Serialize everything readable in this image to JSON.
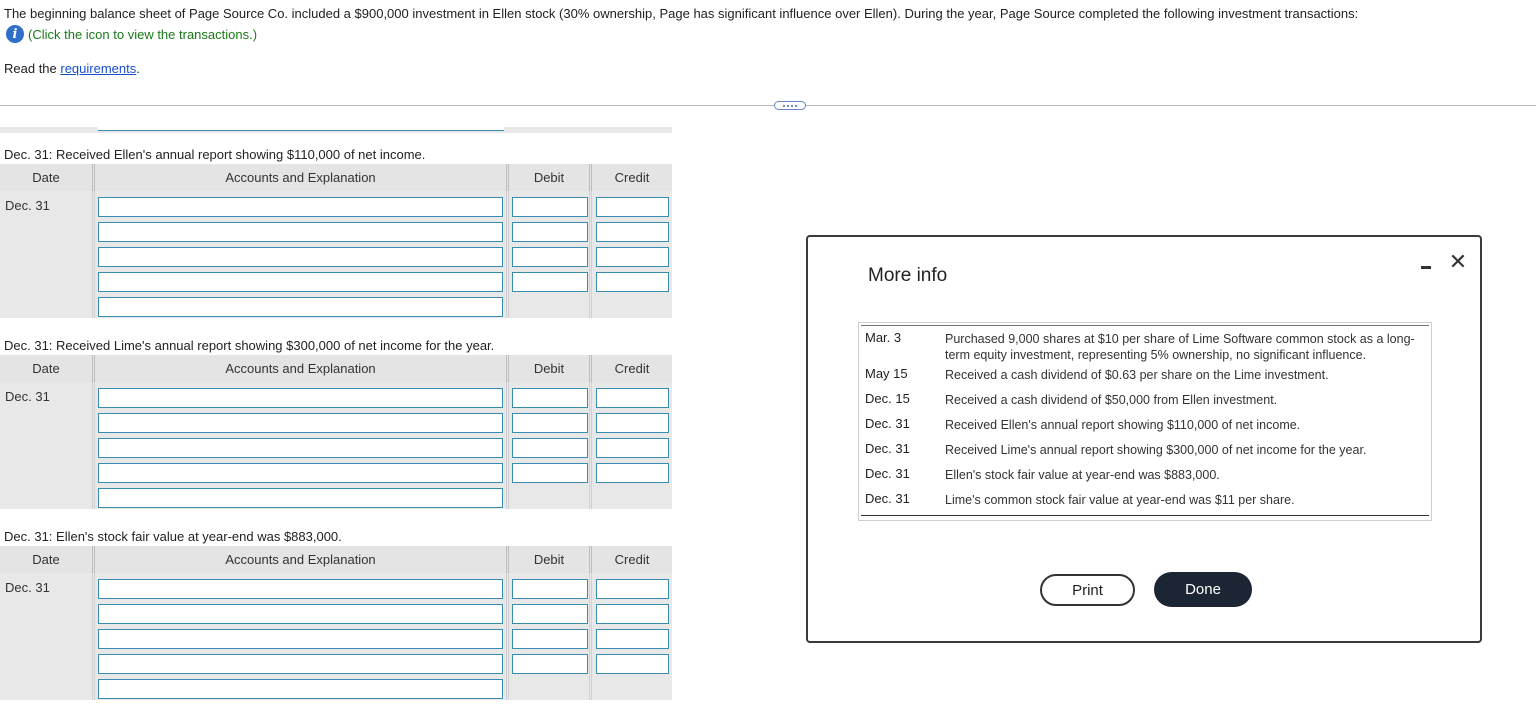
{
  "intro": {
    "text": "The beginning balance sheet of Page Source Co. included a $900,000 investment in Ellen stock (30% ownership, Page has significant influence over Ellen). During the year, Page Source completed the following investment transactions:",
    "info_link": "(Click the icon to view the transactions.)",
    "read_prefix": "Read the ",
    "requirements_link": "requirements",
    "read_suffix": "."
  },
  "table_headers": {
    "date": "Date",
    "accounts": "Accounts and Explanation",
    "debit": "Debit",
    "credit": "Credit"
  },
  "sections": [
    {
      "prompt": "Dec. 31: Received Ellen's annual report showing $110,000 of net income.",
      "date": "Dec. 31"
    },
    {
      "prompt": "Dec. 31: Received Lime's annual report showing $300,000 of net income for the year.",
      "date": "Dec. 31"
    },
    {
      "prompt": "Dec. 31: Ellen's stock fair value at year-end was $883,000.",
      "date": "Dec. 31"
    }
  ],
  "modal": {
    "title": "More info",
    "transactions": [
      {
        "date": "Mar. 3",
        "desc": "Purchased 9,000 shares at $10 per share of Lime Software common stock as a long-term equity investment, representing 5% ownership, no significant influence."
      },
      {
        "date": "May 15",
        "desc": "Received a cash dividend of $0.63 per share on the Lime investment."
      },
      {
        "date": "Dec. 15",
        "desc": "Received a cash dividend of $50,000 from Ellen investment."
      },
      {
        "date": "Dec. 31",
        "desc": "Received Ellen's annual report showing $110,000 of net income."
      },
      {
        "date": "Dec. 31",
        "desc": "Received Lime's annual report showing $300,000 of net income for the year."
      },
      {
        "date": "Dec. 31",
        "desc": "Ellen's stock fair value at year-end was $883,000."
      },
      {
        "date": "Dec. 31",
        "desc": "Lime's common stock fair value at year-end was $11 per share."
      }
    ],
    "print_label": "Print",
    "done_label": "Done",
    "close_glyph": "✕"
  }
}
